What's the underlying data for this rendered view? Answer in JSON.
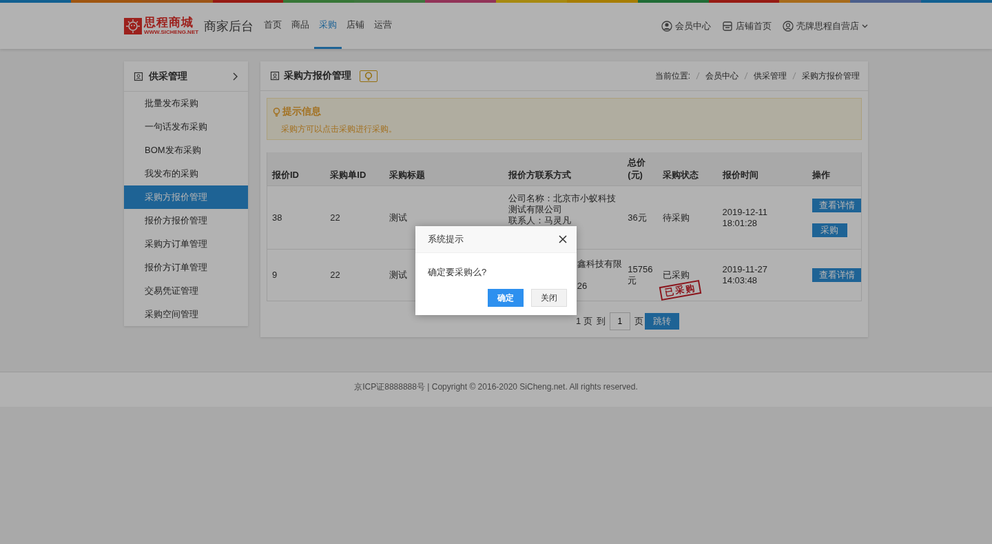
{
  "header": {
    "logo": {
      "name": "思程商城",
      "url": "WWW.SICHENG.NET"
    },
    "title": "商家后台",
    "nav": [
      {
        "label": "首页",
        "selected": false
      },
      {
        "label": "商品",
        "selected": false
      },
      {
        "label": "采购",
        "selected": true
      },
      {
        "label": "店铺",
        "selected": false
      },
      {
        "label": "运营",
        "selected": false
      }
    ],
    "links": [
      {
        "label": "会员中心",
        "kind": "user"
      },
      {
        "label": "店铺首页",
        "kind": "shop"
      },
      {
        "label": "壳牌思程自营店",
        "kind": "account"
      }
    ]
  },
  "sidebar": {
    "title": "供采管理",
    "items": [
      {
        "label": "批量发布采购",
        "selected": false
      },
      {
        "label": "一句话发布采购",
        "selected": false
      },
      {
        "label": "BOM发布采购",
        "selected": false
      },
      {
        "label": "我发布的采购",
        "selected": false
      },
      {
        "label": "采购方报价管理",
        "selected": true
      },
      {
        "label": "报价方报价管理",
        "selected": false
      },
      {
        "label": "采购方订单管理",
        "selected": false
      },
      {
        "label": "报价方订单管理",
        "selected": false
      },
      {
        "label": "交易凭证管理",
        "selected": false
      },
      {
        "label": "采购空间管理",
        "selected": false
      }
    ]
  },
  "panel": {
    "title": "采购方报价管理",
    "breadcrumb": {
      "label": "当前位置:",
      "items": [
        "会员中心",
        "供采管理",
        "采购方报价管理"
      ]
    },
    "tip": {
      "title": "提示信息",
      "text": "采购方可以点击采购进行采购。"
    },
    "table": {
      "columns": [
        "报价ID",
        "采购单ID",
        "采购标题",
        "报价方联系方式",
        "总价(元)",
        "采购状态",
        "报价时间",
        "操作"
      ],
      "rows": [
        {
          "id": "38",
          "order_id": "22",
          "title": "测试",
          "contact": {
            "covered": false,
            "lines": [
              "公司名称：北京市小蚁科技测试有限公司",
              "联系人：马灵凡"
            ]
          },
          "total": "36元",
          "status": "待采购",
          "time": "2019-12-11 18:01:28",
          "actions": [
            {
              "label": "查看详情",
              "kind": "large"
            },
            {
              "label": "采购",
              "kind": "small"
            }
          ]
        },
        {
          "id": "9",
          "order_id": "22",
          "title": "测试",
          "contact": {
            "covered": true,
            "lines": [
              "鑫科技有限",
              "26"
            ]
          },
          "total": "15756元",
          "status": "已采购",
          "stamp": "已采购",
          "time": "2019-11-27 14:03:48",
          "actions": [
            {
              "label": "查看详情",
              "kind": "large"
            }
          ]
        }
      ]
    },
    "pagination": {
      "pages": "1 页",
      "to": "到",
      "value": "1",
      "unit": "页",
      "button": "跳转"
    }
  },
  "footer": "京ICP证8888888号 | Copyright © 2016-2020 SiCheng.net. All rights reserved.",
  "dialog": {
    "title": "系统提示",
    "message": "确定要采购么?",
    "buttons": [
      {
        "label": "确定",
        "kind": "primary"
      },
      {
        "label": "关闭",
        "kind": "default"
      }
    ]
  }
}
